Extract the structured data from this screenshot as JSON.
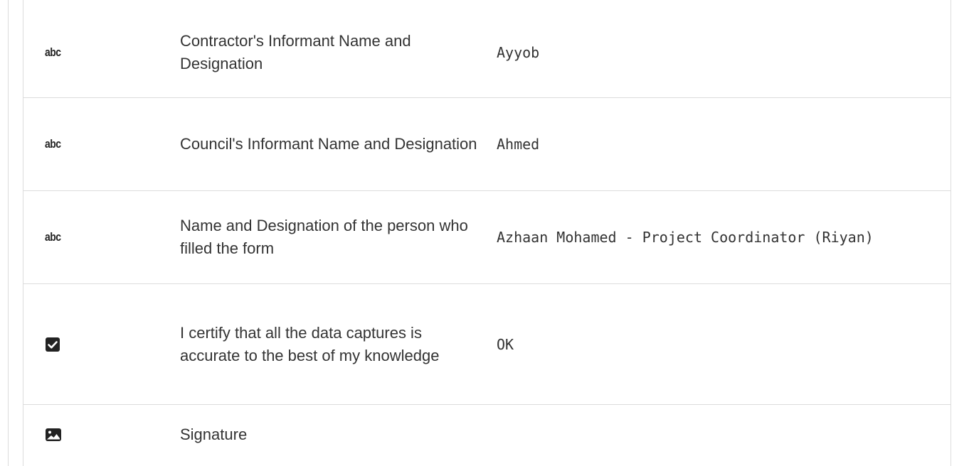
{
  "fields": [
    {
      "type_icon": "abc",
      "label": "Contractor's Informant Name and Designation",
      "value": "Ayyob"
    },
    {
      "type_icon": "abc",
      "label": "Council's Informant Name and Designation",
      "value": "Ahmed"
    },
    {
      "type_icon": "abc",
      "label": "Name and Designation of the person who filled the form",
      "value": "Azhaan Mohamed - Project Coordinator (Riyan)"
    },
    {
      "type_icon": "checkbox-icon",
      "label": "I certify that all the data captures is accurate to the best of my knowledge",
      "value": "OK"
    },
    {
      "type_icon": "image-icon",
      "label": "Signature",
      "value": ""
    }
  ],
  "colors": {
    "border": "#dcdcdc",
    "text": "#333333",
    "icon": "#222222"
  }
}
